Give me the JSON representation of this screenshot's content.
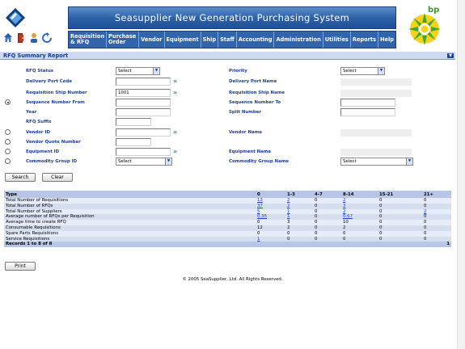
{
  "header": {
    "title": "Seasupplier New Generation Purchasing System",
    "bp_text": "bp"
  },
  "nav_icons": [
    "home-icon",
    "exit-icon",
    "user-icon",
    "refresh-icon"
  ],
  "menu": [
    {
      "label": "Requisition & RFQ"
    },
    {
      "label": "Purchase Order"
    },
    {
      "label": "Vendor"
    },
    {
      "label": "Equipment"
    },
    {
      "label": "Ship"
    },
    {
      "label": "Staff"
    },
    {
      "label": "Accounting"
    },
    {
      "label": "Administration"
    },
    {
      "label": "Utilities"
    },
    {
      "label": "Reports"
    },
    {
      "label": "Help"
    }
  ],
  "report": {
    "title": "RFQ Summary Report"
  },
  "form": {
    "rfq_status": {
      "label": "RFQ Status",
      "value": "Select"
    },
    "priority": {
      "label": "Priority",
      "value": "Select"
    },
    "delivery_port_code": {
      "label": "Delivery Port Code",
      "value": ""
    },
    "delivery_port_name": {
      "label": "Delivery Port Name"
    },
    "requisition_ship_number": {
      "label": "Requisition Ship Number",
      "value": "1001"
    },
    "requisition_ship_name": {
      "label": "Requisition Ship Name"
    },
    "sequence_number_from": {
      "label": "Sequence Number From",
      "value": ""
    },
    "sequence_number_to": {
      "label": "Sequence Number To",
      "value": ""
    },
    "year": {
      "label": "Year",
      "value": ""
    },
    "split_number": {
      "label": "Split Number",
      "value": ""
    },
    "rfq_suffix": {
      "label": "RFQ Suffix",
      "value": ""
    },
    "vendor_id": {
      "label": "Vendor ID",
      "value": ""
    },
    "vendor_name": {
      "label": "Vendor Name"
    },
    "vendor_quote_number": {
      "label": "Vendor Quote Number",
      "value": ""
    },
    "equipment_id": {
      "label": "Equipment ID",
      "value": ""
    },
    "equipment_name": {
      "label": "Equipment Name"
    },
    "commodity_group_id": {
      "label": "Commodity Group ID",
      "value": "Select"
    },
    "commodity_group_name": {
      "label": "Commodity Group Name",
      "value": "Select"
    },
    "search_label": "Search",
    "clear_label": "Clear"
  },
  "table": {
    "headers": [
      "Type",
      "0",
      "1-3",
      "4-7",
      "8-14",
      "15-21",
      "21+"
    ],
    "rows": [
      {
        "type": "Total Number of Requisitions",
        "c0": "13",
        "c1": "2",
        "c2": "0",
        "c3": "2",
        "c4": "0",
        "c5": "0",
        "links": [
          true,
          true,
          false,
          true,
          false,
          false
        ]
      },
      {
        "type": "Total Number of RFQs",
        "c0": "37",
        "c1": "2",
        "c2": "0",
        "c3": "3",
        "c4": "0",
        "c5": "0",
        "links": [
          true,
          true,
          false,
          true,
          false,
          false
        ]
      },
      {
        "type": "Total Number of Suppliers",
        "c0": "5",
        "c1": "1",
        "c2": "0",
        "c3": "2",
        "c4": "0",
        "c5": "2",
        "links": [
          true,
          true,
          false,
          true,
          false,
          true
        ]
      },
      {
        "type": "Average number of RFQs per Requisition",
        "c0": "0.35",
        "c1": "1",
        "c2": "0",
        "c3": "0.67",
        "c4": "0",
        "c5": "0",
        "links": [
          true,
          true,
          false,
          true,
          false,
          false
        ]
      },
      {
        "type": "Average time to create RFQ",
        "c0": "0",
        "c1": "3",
        "c2": "0",
        "c3": "10",
        "c4": "0",
        "c5": "0",
        "links": [
          false,
          false,
          false,
          false,
          false,
          false
        ]
      },
      {
        "type": "Consumable Requisitions",
        "c0": "12",
        "c1": "2",
        "c2": "0",
        "c3": "2",
        "c4": "0",
        "c5": "0",
        "links": [
          false,
          false,
          false,
          false,
          false,
          false
        ]
      },
      {
        "type": "Spare Parts Requisitions",
        "c0": "0",
        "c1": "0",
        "c2": "0",
        "c3": "0",
        "c4": "0",
        "c5": "0",
        "links": [
          false,
          false,
          false,
          false,
          false,
          false
        ]
      },
      {
        "type": "Service Requisitions",
        "c0": "1",
        "c1": "0",
        "c2": "0",
        "c3": "0",
        "c4": "0",
        "c5": "0",
        "links": [
          true,
          false,
          false,
          false,
          false,
          false
        ]
      }
    ],
    "footer_records": "Records 1 to 8 of 8",
    "footer_page": "1"
  },
  "print_label": "Print",
  "copyright": "© 2005 SeaSupplier, Ltd. All Rights Reserved.",
  "colors": {
    "banner": "#2e62a8",
    "menu": "#3164ab",
    "label": "#1c3f94",
    "table_header": "#b7c6e6"
  }
}
